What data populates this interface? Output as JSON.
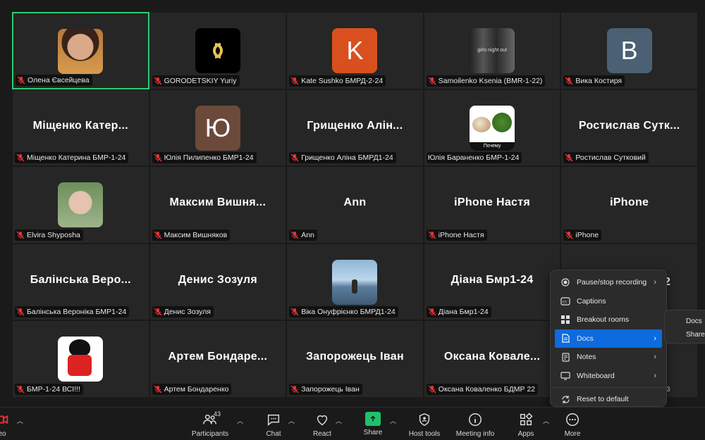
{
  "participants": [
    {
      "label": "Олена Євсейцева",
      "avatar": "photo-woman",
      "active": true
    },
    {
      "label": "GORODETSKIY Yuriy",
      "avatar": "logo"
    },
    {
      "label": "Kate Sushko БМРД-2-24",
      "avatar": "letter",
      "letter": "K",
      "color": "#d9501e"
    },
    {
      "label": "Samoilenko Ksenia (BMR-1-22)",
      "avatar": "movie",
      "caption": "girls night out"
    },
    {
      "label": "Вика Костиря",
      "avatar": "letter",
      "letter": "B",
      "color": "#4b6173"
    },
    {
      "label": "Міщенко Катерина БМР-1-24",
      "name": "Міщенко Катер..."
    },
    {
      "label": "Юлія Пилипенко БМР1-24",
      "avatar": "letter",
      "letter": "Ю",
      "color": "#6b4a3a"
    },
    {
      "label": "Грищенко Аліна БМРД1-24",
      "name": "Грищенко Алін..."
    },
    {
      "label": "Юлія Бараненко БМР-1-24",
      "avatar": "veg",
      "caption": "Почему",
      "no_mic": true
    },
    {
      "label": "Ростислав Сутковий",
      "name": "Ростислав Сутк..."
    },
    {
      "label": "Elvira Shyposha",
      "avatar": "girl"
    },
    {
      "label": "Максим Вишняков",
      "name": "Максим Вишня..."
    },
    {
      "label": "Ann",
      "name": "Ann"
    },
    {
      "label": "iPhone Настя",
      "name": "iPhone Настя"
    },
    {
      "label": "iPhone",
      "name": "iPhone"
    },
    {
      "label": "Балінська Вероніка БМР1-24",
      "name": "Балінська Веро..."
    },
    {
      "label": "Денис Зозуля",
      "name": "Денис Зозуля"
    },
    {
      "label": "Віка Онуфрієнко БМРД1-24",
      "avatar": "sea"
    },
    {
      "label": "Діана Бмр1-24",
      "name": "Діана Бмр1-24"
    },
    {
      "label": "",
      "name": ""
    },
    {
      "label": "БМР-1-24 ВСІ!!!",
      "avatar": "cartoon"
    },
    {
      "label": "Артем Бондаренко",
      "name": "Артем Бондаре..."
    },
    {
      "label": "Запорожець Іван",
      "name": "Запорожець Іван"
    },
    {
      "label": "Оксана Коваленко БДМР 22",
      "name": "Оксана Ковале..."
    },
    {
      "label": "",
      "name": ""
    }
  ],
  "peek": {
    "name_fragment": "2",
    "label_fragment": "3"
  },
  "toolbar": {
    "video_label": "eo",
    "participants_label": "Participants",
    "participants_count": "43",
    "chat_label": "Chat",
    "react_label": "React",
    "share_label": "Share",
    "host_tools_label": "Host tools",
    "meeting_info_label": "Meeting info",
    "apps_label": "Apps",
    "more_label": "More"
  },
  "menu": {
    "items": [
      {
        "label": "Pause/stop recording",
        "icon": "record-icon",
        "submenu": true
      },
      {
        "label": "Captions",
        "icon": "cc-icon"
      },
      {
        "label": "Breakout rooms",
        "icon": "grid-icon"
      },
      {
        "label": "Docs",
        "icon": "doc-icon",
        "submenu": true,
        "highlighted": true
      },
      {
        "label": "Notes",
        "icon": "notes-icon",
        "submenu": true
      },
      {
        "label": "Whiteboard",
        "icon": "whiteboard-icon",
        "submenu": true
      },
      {
        "label": "Reset to default",
        "icon": "reset-icon"
      }
    ],
    "submenu_items": [
      "Docs",
      "Share"
    ]
  },
  "colors": {
    "active_border": "#2ecc71",
    "menu_highlight": "#0e6bdd",
    "share_green": "#1fc16b"
  }
}
